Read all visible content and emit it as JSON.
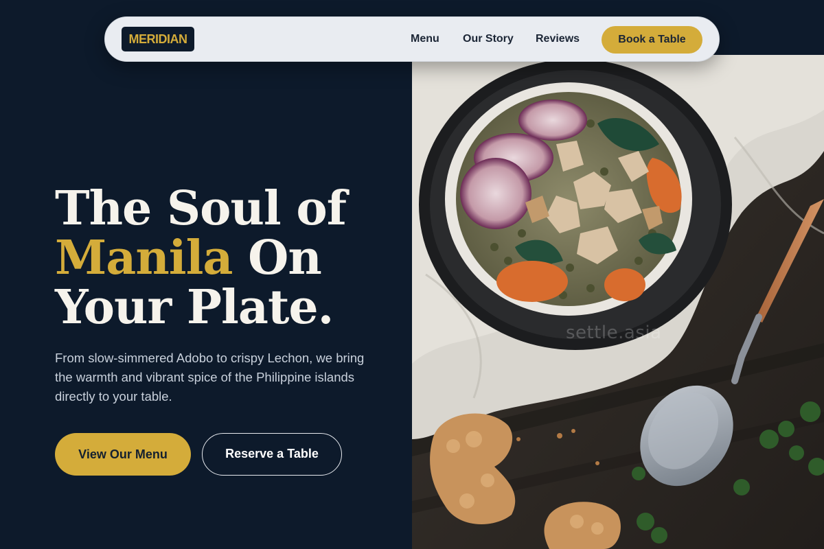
{
  "brand": {
    "logo_text": "MERIDIAN"
  },
  "nav": {
    "links": [
      {
        "label": "Menu"
      },
      {
        "label": "Our Story"
      },
      {
        "label": "Reviews"
      }
    ],
    "cta_label": "Book a Table"
  },
  "hero": {
    "title_line1": "The Soul of",
    "title_accent": "Manila",
    "title_line2_rest": " On",
    "title_line3": "Your Plate.",
    "description": "From slow-simmered Adobo to crispy Lechon, we bring the warmth and vibrant spice of the Philippine islands directly to your table.",
    "primary_button": "View Our Menu",
    "secondary_button": "Reserve a Table"
  },
  "image": {
    "watermark": "settle.asia"
  },
  "colors": {
    "background": "#0d1a2b",
    "accent": "#d4ac3a",
    "nav_background": "#e9ecf1",
    "heading_text": "#f6f3ec",
    "body_text": "#c9d1dc"
  }
}
